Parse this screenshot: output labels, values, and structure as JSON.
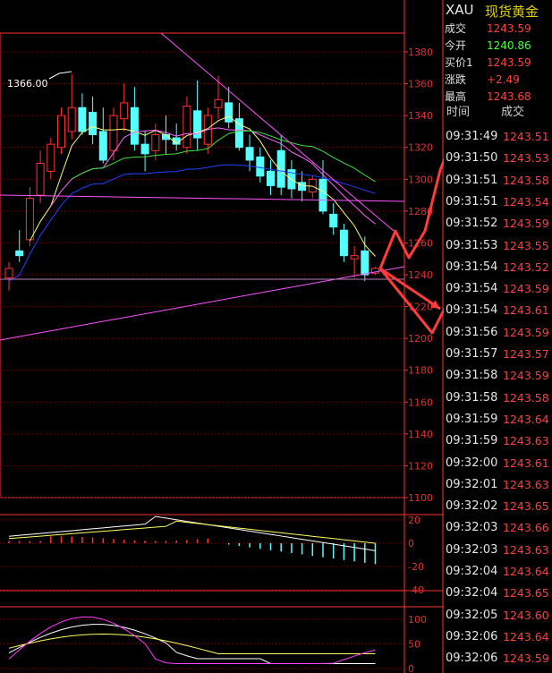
{
  "header": {
    "symbol": "XAU",
    "name": "现货黄金"
  },
  "quote": [
    {
      "label": "成交",
      "value": "1243.59",
      "color": "#ff4040"
    },
    {
      "label": "今开",
      "value": "1240.86",
      "color": "#40ff40"
    },
    {
      "label": "买价1",
      "value": "1243.59",
      "color": "#ff4040"
    },
    {
      "label": "涨跌",
      "value": "+2.49",
      "color": "#ff4040"
    },
    {
      "label": "最高",
      "value": "1243.68",
      "color": "#ff4040"
    }
  ],
  "ticks_header": {
    "time": "时间",
    "price": "成交"
  },
  "ticks": [
    {
      "time": "09:31:49",
      "price": "1243.51"
    },
    {
      "time": "09:31:50",
      "price": "1243.53"
    },
    {
      "time": "09:31:51",
      "price": "1243.58"
    },
    {
      "time": "09:31:51",
      "price": "1243.54"
    },
    {
      "time": "09:31:52",
      "price": "1243.59"
    },
    {
      "time": "09:31:53",
      "price": "1243.55"
    },
    {
      "time": "09:31:54",
      "price": "1243.52"
    },
    {
      "time": "09:31:54",
      "price": "1243.59"
    },
    {
      "time": "09:31:54",
      "price": "1243.61"
    },
    {
      "time": "09:31:56",
      "price": "1243.59"
    },
    {
      "time": "09:31:57",
      "price": "1243.57"
    },
    {
      "time": "09:31:58",
      "price": "1243.59"
    },
    {
      "time": "09:31:58",
      "price": "1243.58"
    },
    {
      "time": "09:31:59",
      "price": "1243.64"
    },
    {
      "time": "09:31:59",
      "price": "1243.63"
    },
    {
      "time": "09:32:00",
      "price": "1243.61"
    },
    {
      "time": "09:32:01",
      "price": "1243.63"
    },
    {
      "time": "09:32:02",
      "price": "1243.65"
    },
    {
      "time": "09:32:03",
      "price": "1243.66"
    },
    {
      "time": "09:32:03",
      "price": "1243.63"
    },
    {
      "time": "09:32:04",
      "price": "1243.64"
    },
    {
      "time": "09:32:04",
      "price": "1243.65"
    },
    {
      "time": "09:32:05",
      "price": "1243.60"
    },
    {
      "time": "09:32:06",
      "price": "1243.64"
    },
    {
      "time": "09:32:06",
      "price": "1243.59"
    }
  ],
  "chart_data": [
    {
      "type": "candlestick",
      "annotations": [
        "1366.00"
      ],
      "y_ticks": [
        1380,
        1360,
        1340,
        1320,
        1300,
        1280,
        1260,
        1240,
        1220,
        1200,
        1180,
        1160,
        1140,
        1120,
        1100
      ],
      "ylim": [
        1100,
        1390
      ],
      "candles": [
        {
          "o": 1238,
          "h": 1248,
          "l": 1230,
          "c": 1244
        },
        {
          "o": 1255,
          "h": 1268,
          "l": 1248,
          "c": 1252
        },
        {
          "o": 1262,
          "h": 1295,
          "l": 1258,
          "c": 1288
        },
        {
          "o": 1290,
          "h": 1318,
          "l": 1285,
          "c": 1310
        },
        {
          "o": 1305,
          "h": 1326,
          "l": 1300,
          "c": 1322
        },
        {
          "o": 1320,
          "h": 1345,
          "l": 1316,
          "c": 1340
        },
        {
          "o": 1330,
          "h": 1366,
          "l": 1325,
          "c": 1345
        },
        {
          "o": 1345,
          "h": 1354,
          "l": 1328,
          "c": 1330
        },
        {
          "o": 1342,
          "h": 1352,
          "l": 1322,
          "c": 1328
        },
        {
          "o": 1330,
          "h": 1345,
          "l": 1310,
          "c": 1312
        },
        {
          "o": 1318,
          "h": 1345,
          "l": 1312,
          "c": 1340
        },
        {
          "o": 1338,
          "h": 1360,
          "l": 1330,
          "c": 1348
        },
        {
          "o": 1345,
          "h": 1358,
          "l": 1318,
          "c": 1322
        },
        {
          "o": 1322,
          "h": 1330,
          "l": 1305,
          "c": 1316
        },
        {
          "o": 1318,
          "h": 1335,
          "l": 1312,
          "c": 1328
        },
        {
          "o": 1328,
          "h": 1340,
          "l": 1316,
          "c": 1325
        },
        {
          "o": 1326,
          "h": 1335,
          "l": 1318,
          "c": 1322
        },
        {
          "o": 1320,
          "h": 1352,
          "l": 1316,
          "c": 1346
        },
        {
          "o": 1343,
          "h": 1362,
          "l": 1318,
          "c": 1326
        },
        {
          "o": 1322,
          "h": 1345,
          "l": 1316,
          "c": 1340
        },
        {
          "o": 1345,
          "h": 1365,
          "l": 1338,
          "c": 1350
        },
        {
          "o": 1348,
          "h": 1358,
          "l": 1332,
          "c": 1336
        },
        {
          "o": 1338,
          "h": 1348,
          "l": 1318,
          "c": 1320
        },
        {
          "o": 1320,
          "h": 1328,
          "l": 1305,
          "c": 1312
        },
        {
          "o": 1314,
          "h": 1320,
          "l": 1298,
          "c": 1302
        },
        {
          "o": 1305,
          "h": 1312,
          "l": 1290,
          "c": 1296
        },
        {
          "o": 1318,
          "h": 1328,
          "l": 1290,
          "c": 1295
        },
        {
          "o": 1306,
          "h": 1312,
          "l": 1288,
          "c": 1294
        },
        {
          "o": 1298,
          "h": 1305,
          "l": 1286,
          "c": 1293
        },
        {
          "o": 1292,
          "h": 1302,
          "l": 1288,
          "c": 1300
        },
        {
          "o": 1300,
          "h": 1312,
          "l": 1278,
          "c": 1280
        },
        {
          "o": 1278,
          "h": 1285,
          "l": 1265,
          "c": 1270
        },
        {
          "o": 1268,
          "h": 1272,
          "l": 1248,
          "c": 1252
        },
        {
          "o": 1250,
          "h": 1258,
          "l": 1238,
          "c": 1252
        },
        {
          "o": 1255,
          "h": 1264,
          "l": 1236,
          "c": 1240
        },
        {
          "o": 1241,
          "h": 1245,
          "l": 1240,
          "c": 1244
        }
      ]
    },
    {
      "type": "histogram",
      "y_ticks": [
        20,
        0,
        -20,
        -40
      ],
      "ylim": [
        -40,
        28
      ]
    },
    {
      "type": "line",
      "y_ticks": [
        100,
        50,
        0
      ],
      "ylim": [
        0,
        110
      ]
    }
  ],
  "colors": {
    "up": "#ff3232",
    "down": "#54ffff",
    "grid": "#7a0000",
    "axis": "#ff3232",
    "arrow": "#ff3b3b"
  }
}
